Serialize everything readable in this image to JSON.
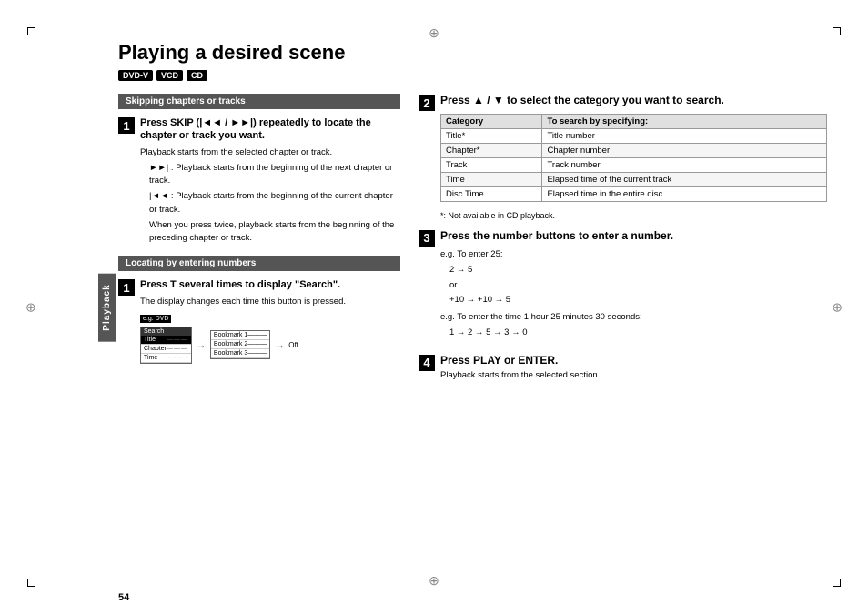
{
  "page": {
    "title": "Playing a desired scene",
    "page_number": "54",
    "badges": [
      "DVD-V",
      "VCD",
      "CD"
    ],
    "side_tab": "Playback"
  },
  "left_column": {
    "section1": {
      "header": "Skipping chapters or tracks",
      "step1": {
        "num": "1",
        "title": "Press SKIP (|◄◄ / ►►|) repeatedly to locate the chapter or track you want.",
        "body_intro": "Playback starts from the selected chapter or track.",
        "bullets": [
          "►►| : Playback starts from the beginning of the next chapter or track.",
          "|◄◄ : Playback starts from the beginning of the current chapter or track.",
          "When you press twice, playback starts from the beginning of the preceding chapter or track."
        ]
      }
    },
    "section2": {
      "header": "Locating by entering numbers",
      "step1": {
        "num": "1",
        "title": "Press T several times to display \"Search\".",
        "body": "The display changes each time this button is pressed.",
        "diagram": {
          "dvd_label": "e.g. DVD",
          "menu1": {
            "header": "Search",
            "items": [
              {
                "label": "Title",
                "dots": "———",
                "selected": true
              },
              {
                "label": "Chapter",
                "dots": "———",
                "selected": false
              },
              {
                "label": "Time",
                "dots": "- - - -",
                "selected": false
              }
            ]
          },
          "arrow": "→",
          "menu2": {
            "items": [
              {
                "label": "Bookmark 1",
                "dots": "———"
              },
              {
                "label": "Bookmark 2",
                "dots": "———"
              },
              {
                "label": "Bookmark 3",
                "dots": "———"
              }
            ]
          },
          "arrow2": "→",
          "off": "Off"
        }
      }
    }
  },
  "right_column": {
    "step2": {
      "num": "2",
      "title": "Press ▲ / ▼ to select the category you want to search.",
      "table": {
        "headers": [
          "Category",
          "To search by specifying:"
        ],
        "rows": [
          [
            "Title*",
            "Title number"
          ],
          [
            "Chapter*",
            "Chapter number"
          ],
          [
            "Track",
            "Track number"
          ],
          [
            "Time",
            "Elapsed time of the current track"
          ],
          [
            "Disc Time",
            "Elapsed time in the entire disc"
          ]
        ],
        "footnote": "*: Not available in CD playback."
      }
    },
    "step3": {
      "num": "3",
      "title": "Press the number buttons to enter a number.",
      "examples": [
        {
          "label": "e.g. To enter 25:",
          "lines": [
            "2 → 5",
            "or",
            "+10 → +10 → 5"
          ]
        },
        {
          "label": "e.g. To enter the time 1 hour 25 minutes 30 seconds:",
          "lines": [
            "1 → 2 → 5 → 3 → 0"
          ]
        }
      ]
    },
    "step4": {
      "num": "4",
      "title": "Press PLAY or ENTER.",
      "body": "Playback starts from the selected section."
    }
  },
  "crosshairs": {
    "top": "⊕",
    "bottom": "⊕",
    "left": "⊕",
    "right": "⊕"
  }
}
